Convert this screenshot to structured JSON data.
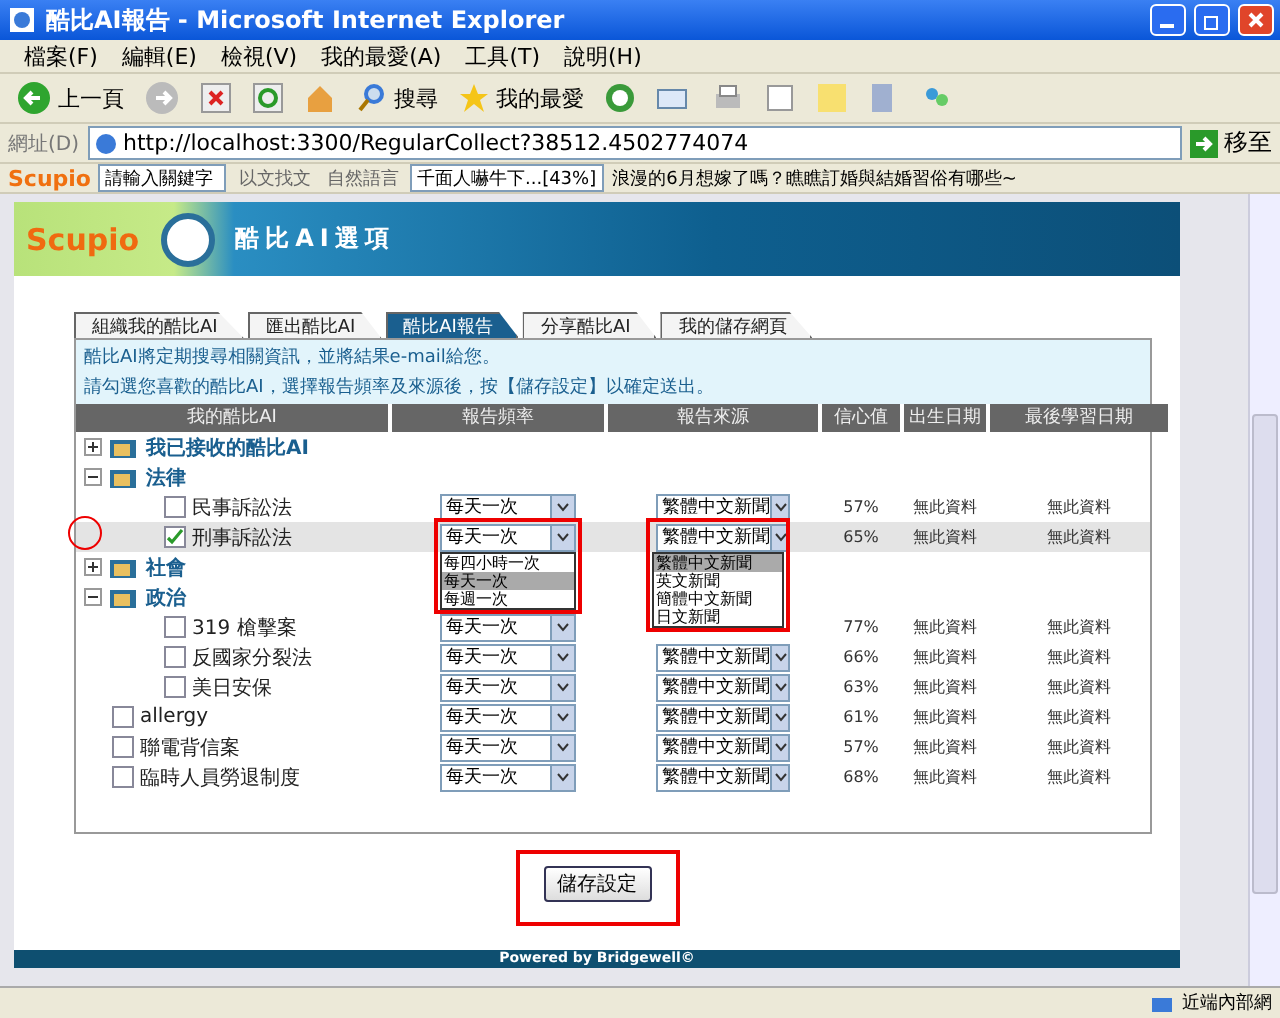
{
  "window": {
    "title": "酷比AI報告 - Microsoft Internet Explorer"
  },
  "menu": [
    "檔案(F)",
    "編輯(E)",
    "檢視(V)",
    "我的最愛(A)",
    "工具(T)",
    "說明(H)"
  ],
  "toolbar": {
    "back": "上一頁",
    "search": "搜尋",
    "favorites": "我的最愛"
  },
  "address": {
    "label": "網址(D)",
    "url": "http://localhost:3300/RegularCollect?38512.4502774074",
    "go": "移至"
  },
  "scupio_bar": {
    "logo": "Scupio",
    "placeholder": "請輸入關鍵字",
    "text_search": "以文找文",
    "natural": "自然語言",
    "history": "千面人嚇牛下...[43%]",
    "news": "浪漫的6月想嫁了嗎？瞧瞧訂婚與結婚習俗有哪些~"
  },
  "banner": {
    "logo": "Scupio",
    "title": "酷比AI選項"
  },
  "tabs": [
    {
      "label": "組織我的酷比AI",
      "selected": false
    },
    {
      "label": "匯出酷比AI",
      "selected": false
    },
    {
      "label": "酷比AI報告",
      "selected": true
    },
    {
      "label": "分享酷比AI",
      "selected": false
    },
    {
      "label": "我的儲存網頁",
      "selected": false
    }
  ],
  "info": [
    "酷比AI將定期搜尋相關資訊，並將結果e-mail給您。",
    "請勾選您喜歡的酷比AI，選擇報告頻率及來源後，按【儲存設定】以確定送出。"
  ],
  "columns": [
    "我的酷比AI",
    "報告頻率",
    "報告來源",
    "信心值",
    "出生日期",
    "最後學習日期"
  ],
  "tree": [
    {
      "kind": "folder",
      "label": "我已接收的酷比AI",
      "expanded": false
    },
    {
      "kind": "folder",
      "label": "法律",
      "expanded": true,
      "children": [
        {
          "kind": "leaf",
          "label": "民事訴訟法",
          "checked": false,
          "frequency": "每天一次",
          "source": "繁體中文新聞",
          "confidence": "57%",
          "born": "無此資料",
          "learned": "無此資料"
        },
        {
          "kind": "leaf",
          "label": "刑事訴訟法",
          "checked": true,
          "frequency": "每天一次",
          "source": "繁體中文新聞",
          "confidence": "65%",
          "born": "無此資料",
          "learned": "無此資料",
          "frequency_options": [
            {
              "label": "每四小時一次",
              "selected": false
            },
            {
              "label": "每天一次",
              "selected": true
            },
            {
              "label": "每週一次",
              "selected": false
            }
          ],
          "source_options": [
            {
              "label": "繁體中文新聞",
              "selected": true
            },
            {
              "label": "英文新聞",
              "selected": false
            },
            {
              "label": "簡體中文新聞",
              "selected": false
            },
            {
              "label": "日文新聞",
              "selected": false
            }
          ]
        }
      ]
    },
    {
      "kind": "folder",
      "label": "社會",
      "expanded": false
    },
    {
      "kind": "folder",
      "label": "政治",
      "expanded": true,
      "children": [
        {
          "kind": "leaf",
          "label": "319 槍擊案",
          "checked": false,
          "frequency": "每天一次",
          "confidence": "77%",
          "born": "無此資料",
          "learned": "無此資料"
        },
        {
          "kind": "leaf",
          "label": "反國家分裂法",
          "checked": false,
          "frequency": "每天一次",
          "source": "繁體中文新聞",
          "confidence": "66%",
          "born": "無此資料",
          "learned": "無此資料"
        },
        {
          "kind": "leaf",
          "label": "美日安保",
          "checked": false,
          "frequency": "每天一次",
          "source": "繁體中文新聞",
          "confidence": "63%",
          "born": "無此資料",
          "learned": "無此資料"
        }
      ]
    },
    {
      "kind": "leaf",
      "label": "allergy",
      "checked": false,
      "frequency": "每天一次",
      "source": "繁體中文新聞",
      "confidence": "61%",
      "born": "無此資料",
      "learned": "無此資料"
    },
    {
      "kind": "leaf",
      "label": "聯電背信案",
      "checked": false,
      "frequency": "每天一次",
      "source": "繁體中文新聞",
      "confidence": "57%",
      "born": "無此資料",
      "learned": "無此資料"
    },
    {
      "kind": "leaf",
      "label": "臨時人員勞退制度",
      "checked": false,
      "frequency": "每天一次",
      "source": "繁體中文新聞",
      "confidence": "68%",
      "born": "無此資料",
      "learned": "無此資料"
    }
  ],
  "save_button": "儲存設定",
  "footer": "Powered by Bridgewell©",
  "status_bar": {
    "zone": "近端內部網"
  }
}
